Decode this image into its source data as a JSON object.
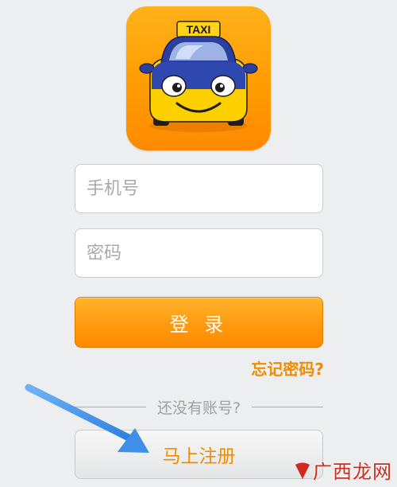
{
  "app_icon": {
    "icon": "taxi-car-icon",
    "sign_text": "TAXI",
    "background_color": "#ff9a00",
    "car_color": "#2a3f9e"
  },
  "login_form": {
    "phone_placeholder": "手机号",
    "password_placeholder": "密码",
    "login_label": "登 录",
    "forgot_password_label": "忘记密码?"
  },
  "signup": {
    "prompt": "还没有账号?",
    "register_label": "马上注册"
  },
  "annotation": {
    "icon": "blue-pointer-arrow-icon",
    "color": "#3f8fe8"
  },
  "watermark": {
    "text": "广西龙网"
  },
  "colors": {
    "accent_orange": "#ff9a10",
    "link_orange": "#f08c00",
    "page_background": "#eceef0"
  }
}
